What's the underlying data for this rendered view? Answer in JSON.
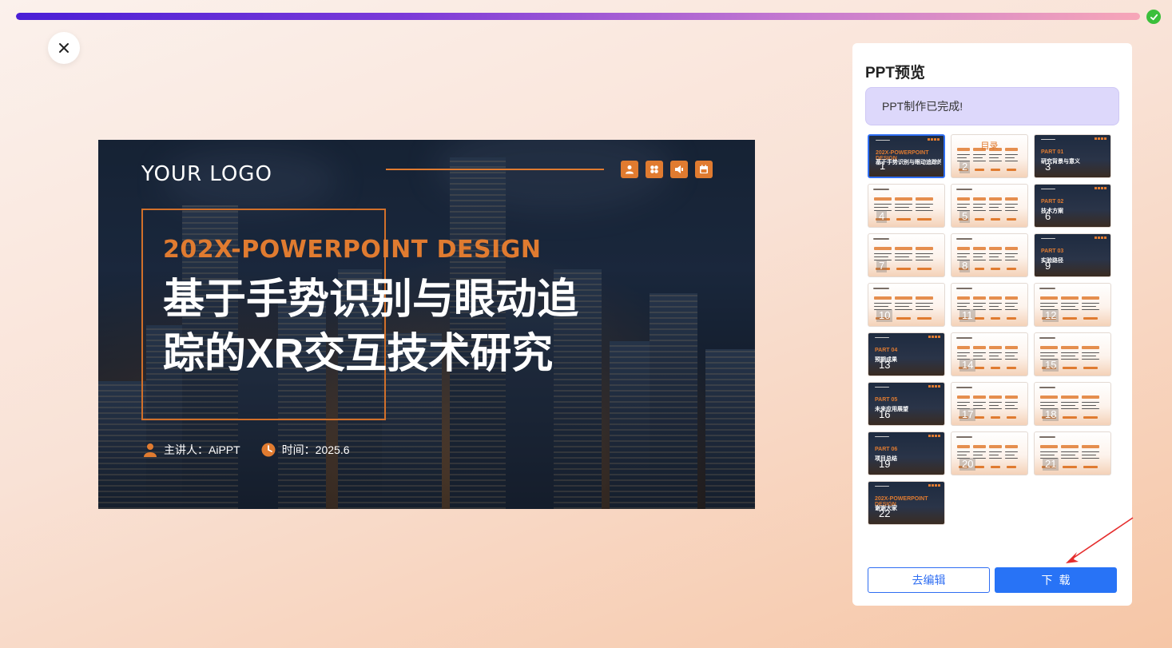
{
  "progress": {
    "percent": 100,
    "complete_icon": "check-circle-icon",
    "color_start": "#4a1fd6",
    "color_end": "#f7a6b8"
  },
  "close_icon": "close-icon",
  "slide": {
    "logo": "YOUR LOGO",
    "subtitle": "202X-POWERPOINT DESIGN",
    "title_line1": "基于手势识别与眼动追",
    "title_line2": "踪的XR交互技术研究",
    "presenter": "主讲人：AiPPT",
    "time": "时间：2025.6",
    "icons": [
      "user-icon",
      "clover-icon",
      "speaker-icon",
      "calendar-icon"
    ],
    "accent": "#e07b30"
  },
  "panel": {
    "title": "PPT预览",
    "status": "PPT制作已完成!",
    "thumbnails": [
      {
        "n": "1",
        "theme": "dark",
        "selected": true,
        "part": "202X-POWERPOINT DESIGN",
        "text": "基于手势识别与眼动追踪的XR交互技术研究"
      },
      {
        "n": "2",
        "theme": "light",
        "selected": false,
        "part": "",
        "text": "目录"
      },
      {
        "n": "3",
        "theme": "dark",
        "selected": false,
        "part": "PART 01",
        "text": "研究背景与意义"
      },
      {
        "n": "4",
        "theme": "light",
        "selected": false,
        "part": "",
        "text": ""
      },
      {
        "n": "5",
        "theme": "light",
        "selected": false,
        "part": "",
        "text": ""
      },
      {
        "n": "6",
        "theme": "dark",
        "selected": false,
        "part": "PART 02",
        "text": "技术方案"
      },
      {
        "n": "7",
        "theme": "light",
        "selected": false,
        "part": "",
        "text": ""
      },
      {
        "n": "8",
        "theme": "light",
        "selected": false,
        "part": "",
        "text": ""
      },
      {
        "n": "9",
        "theme": "dark",
        "selected": false,
        "part": "PART 03",
        "text": "实验路径"
      },
      {
        "n": "10",
        "theme": "light",
        "selected": false,
        "part": "",
        "text": ""
      },
      {
        "n": "11",
        "theme": "light",
        "selected": false,
        "part": "",
        "text": ""
      },
      {
        "n": "12",
        "theme": "light",
        "selected": false,
        "part": "",
        "text": ""
      },
      {
        "n": "13",
        "theme": "dark",
        "selected": false,
        "part": "PART 04",
        "text": "预期成果"
      },
      {
        "n": "14",
        "theme": "light",
        "selected": false,
        "part": "",
        "text": ""
      },
      {
        "n": "15",
        "theme": "light",
        "selected": false,
        "part": "",
        "text": ""
      },
      {
        "n": "16",
        "theme": "dark",
        "selected": false,
        "part": "PART 05",
        "text": "未来应用展望"
      },
      {
        "n": "17",
        "theme": "light",
        "selected": false,
        "part": "",
        "text": ""
      },
      {
        "n": "18",
        "theme": "light",
        "selected": false,
        "part": "",
        "text": ""
      },
      {
        "n": "19",
        "theme": "dark",
        "selected": false,
        "part": "PART 06",
        "text": "项目总结"
      },
      {
        "n": "20",
        "theme": "light",
        "selected": false,
        "part": "",
        "text": ""
      },
      {
        "n": "21",
        "theme": "light",
        "selected": false,
        "part": "",
        "text": ""
      },
      {
        "n": "22",
        "theme": "dark",
        "selected": false,
        "part": "202X-POWERPOINT DESIGN",
        "text": "谢谢大家"
      }
    ],
    "edit_label": "去编辑",
    "download_label": "下载",
    "primary_color": "#2873f6"
  }
}
